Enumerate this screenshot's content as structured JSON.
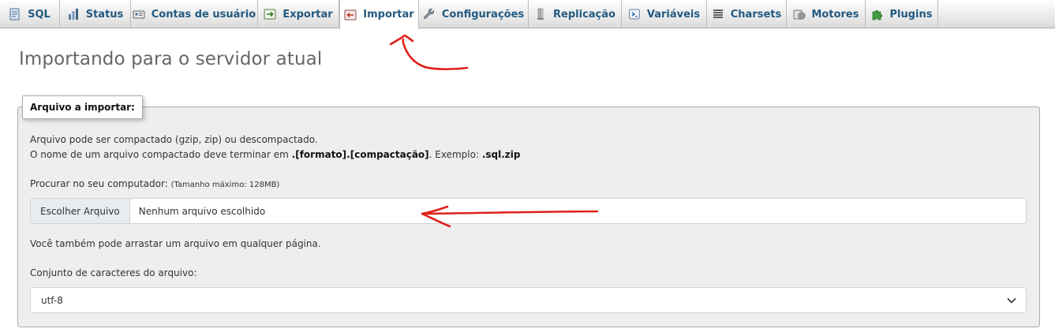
{
  "tabs": [
    {
      "label": "SQL",
      "icon": "sql-icon",
      "active": false
    },
    {
      "label": "Status",
      "icon": "status-chart-icon",
      "active": false
    },
    {
      "label": "Contas de usuário",
      "icon": "user-accounts-icon",
      "active": false
    },
    {
      "label": "Exportar",
      "icon": "export-icon",
      "active": false
    },
    {
      "label": "Importar",
      "icon": "import-icon",
      "active": true
    },
    {
      "label": "Configurações",
      "icon": "wrench-icon",
      "active": false
    },
    {
      "label": "Replicação",
      "icon": "replication-icon",
      "active": false
    },
    {
      "label": "Variáveis",
      "icon": "variables-icon",
      "active": false
    },
    {
      "label": "Charsets",
      "icon": "charsets-icon",
      "active": false
    },
    {
      "label": "Motores",
      "icon": "engines-icon",
      "active": false
    },
    {
      "label": "Plugins",
      "icon": "puzzle-icon",
      "active": false
    }
  ],
  "page": {
    "title": "Importando para o servidor atual"
  },
  "file_section": {
    "legend": "Arquivo a importar:",
    "line1": "Arquivo pode ser compactado (gzip, zip) ou descompactado.",
    "line2_prefix": "O nome de um arquivo compactado deve terminar em ",
    "line2_format": ".[formato].[compactação]",
    "line2_mid": ". Exemplo: ",
    "line2_example": ".sql.zip",
    "browse_label": "Procurar no seu computador:",
    "max_size": "(Tamanho máximo: 128MB)",
    "choose_button": "Escolher Arquivo",
    "no_file": "Nenhum arquivo escolhido",
    "drag_hint": "Você também pode arrastar um arquivo em qualquer página.",
    "charset_label": "Conjunto de caracteres do arquivo:",
    "charset_value": "utf-8"
  },
  "colors": {
    "tab_text": "#235a81",
    "annotation": "#e0201b"
  }
}
